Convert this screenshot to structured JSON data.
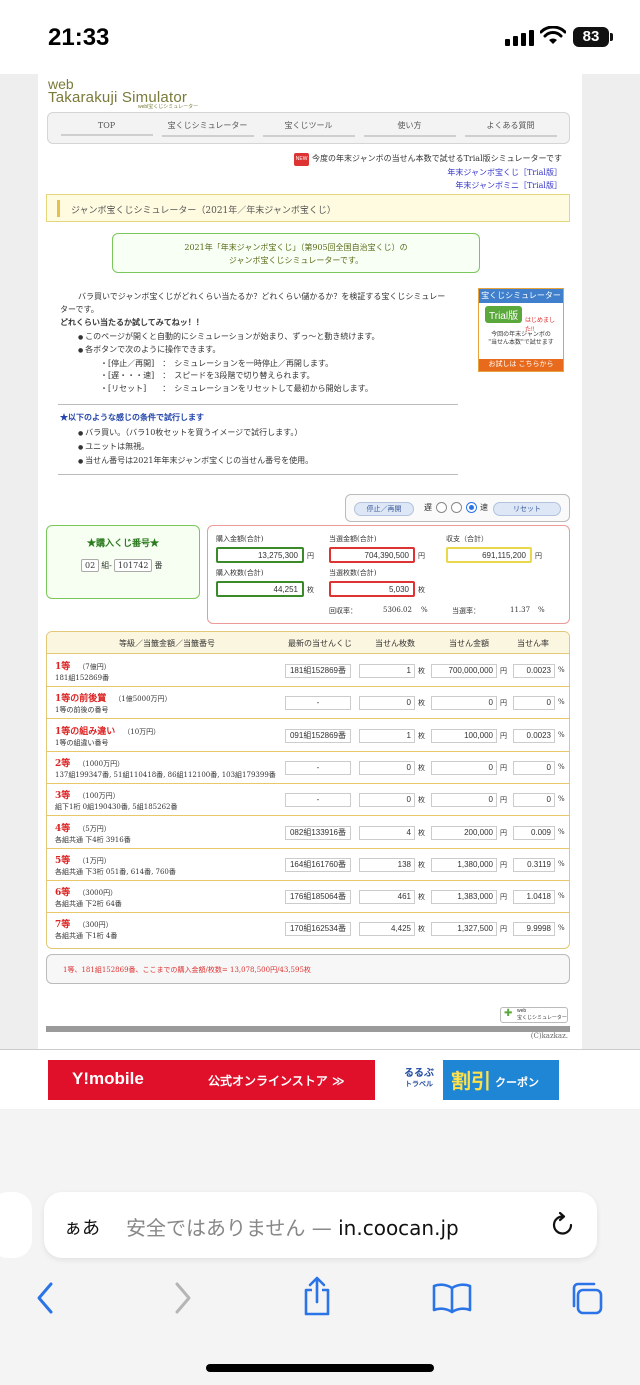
{
  "status": {
    "time": "21:33",
    "battery": "83"
  },
  "site": {
    "logo": {
      "line1": "web",
      "line2": "Takarakuji Simulator",
      "line3": "webl宝くじシミュレーター"
    },
    "nav": [
      "TOP",
      "宝くじシミュレーター",
      "宝くじツール",
      "使い方",
      "よくある質問"
    ],
    "new_badge": "NEW",
    "trial_note": "今度の年末ジャンボの当せん本数で試せるTrial版シミュレーターです",
    "trial_links": [
      "年末ジャンボ宝くじ［Trial版］",
      "年末ジャンボミニ［Trial版］"
    ],
    "section_title": "ジャンボ宝くじシミュレーター（2021年／年末ジャンボ宝くじ）",
    "intro_box": [
      "2021年「年末ジャンボ宝くじ」（第905回全国自治宝くじ）の",
      "ジャンボ宝くじシミュレーターです。"
    ],
    "intro_text": [
      "バラ買いでジャンボ宝くじがどれくらい当たるか？どれくらい儲かるか？を検証する宝くじシミュレー",
      "ターです。"
    ],
    "intro_bold": "どれくらい当たるか試してみてねッ！！",
    "bullets": [
      "このページが開くと自動的にシミュレーションが始まり、ずっ～と動き続けます。",
      "各ボタンで次のように操作できます。"
    ],
    "ops": [
      "・[停止／再開]　：　シミュレーションを一時停止／再開します。",
      "・[遅・・・速]　：　スピードを3段階で切り替えられます。",
      "・[リセット]　　：　シミュレーションをリセットして最初から開始します。"
    ],
    "cond_head": "★以下のような感じの条件で試行します",
    "cond_items": [
      "バラ買い。（バラ10枚セットを買うイメージで試行します。）",
      "ユニットは無視。",
      "当せん番号は2021年年末ジャンボ宝くじの当せん番号を使用。"
    ],
    "ad_trial": {
      "head": "宝くじシミュレーター",
      "badge": "Trial版",
      "new": "はじめました!!",
      "text": [
        "今回の年末ジャンボの",
        "\"当せん本数\"で試せます"
      ],
      "foot": "お試しは こちらから"
    }
  },
  "controls": {
    "stop": "停止／再開",
    "slow": "遅",
    "fast": "速",
    "reset": "リセット",
    "speed_selected": 3
  },
  "ticket": {
    "title": "★購入くじ番号★",
    "group": "02",
    "group_unit": "組-",
    "number": "101742",
    "number_unit": "番"
  },
  "stats": {
    "purchase_amount_label": "購入金額(合計)",
    "purchase_amount": "13,275,300",
    "yen": "円",
    "win_amount_label": "当選金額(合計)",
    "win_amount": "704,390,500",
    "balance_label": "収支（合計）",
    "balance": "691,115,200",
    "purchase_count_label": "購入枚数(合計)",
    "purchase_count": "44,251",
    "mai": "枚",
    "win_count_label": "当選枚数(合計)",
    "win_count": "5,030",
    "recovery_label": "回収率：",
    "recovery": "5306.02",
    "pct": "%",
    "win_rate_label": "当選率：",
    "win_rate": "11.37"
  },
  "table": {
    "headers": [
      "等級／当籤金額／当籤番号",
      "最新の当せんくじ",
      "当せん枚数",
      "当せん金額",
      "当せん率"
    ],
    "rows": [
      {
        "name": "1等",
        "amount": "（7億円）",
        "sub": "181組152869番",
        "latest": "181組152869番",
        "count": "1",
        "money": "700,000,000",
        "rate": "0.0023"
      },
      {
        "name": "1等の前後賞",
        "amount": "（1億5000万円）",
        "sub": "1等の前後の番号",
        "latest": "-",
        "count": "0",
        "money": "0",
        "rate": "0"
      },
      {
        "name": "1等の組み違い",
        "amount": "（10万円）",
        "sub": "1等の組違い番号",
        "latest": "091組152869番",
        "count": "1",
        "money": "100,000",
        "rate": "0.0023"
      },
      {
        "name": "2等",
        "amount": "（1000万円）",
        "sub": "137組199347番, 51組110418番, 86組112100番, 103組179399番",
        "latest": "-",
        "count": "0",
        "money": "0",
        "rate": "0"
      },
      {
        "name": "3等",
        "amount": "（100万円）",
        "sub": "組下1桁 0組190430番, 5組185262番",
        "latest": "-",
        "count": "0",
        "money": "0",
        "rate": "0"
      },
      {
        "name": "4等",
        "amount": "（5万円）",
        "sub": "各組共通 下4桁 3916番",
        "latest": "082組133916番",
        "count": "4",
        "money": "200,000",
        "rate": "0.009"
      },
      {
        "name": "5等",
        "amount": "（1万円）",
        "sub": "各組共通 下3桁 051番, 614番, 760番",
        "latest": "164組161760番",
        "count": "138",
        "money": "1,380,000",
        "rate": "0.3119"
      },
      {
        "name": "6等",
        "amount": "（3000円）",
        "sub": "各組共通 下2桁 64番",
        "latest": "176組185064番",
        "count": "461",
        "money": "1,383,000",
        "rate": "1.0418"
      },
      {
        "name": "7等",
        "amount": "（300円）",
        "sub": "各組共通 下1桁 4番",
        "latest": "170組162534番",
        "count": "4,425",
        "money": "1,327,500",
        "rate": "9.9998"
      }
    ],
    "unit_mai": "枚",
    "unit_yen": "円",
    "unit_pct": "%"
  },
  "message": "1等、181組152869番、ここまでの購入金額/枚数= 13,078,500円/43,595枚",
  "footer": {
    "logo": [
      "web",
      "宝くじシミュレーター"
    ],
    "copyright": "(C)kazkaz."
  },
  "ads": {
    "ymobile": "Y!mobile",
    "ymobile_text": "公式オンラインストア ≫",
    "rurubu": [
      "るるぶ",
      "トラベル"
    ],
    "rurubu_big": "割引",
    "rurubu_small": "クーポン"
  },
  "browser": {
    "aa": "ぁあ",
    "url_prefix": "安全ではありません — ",
    "url_domain": "in.coocan.jp"
  }
}
